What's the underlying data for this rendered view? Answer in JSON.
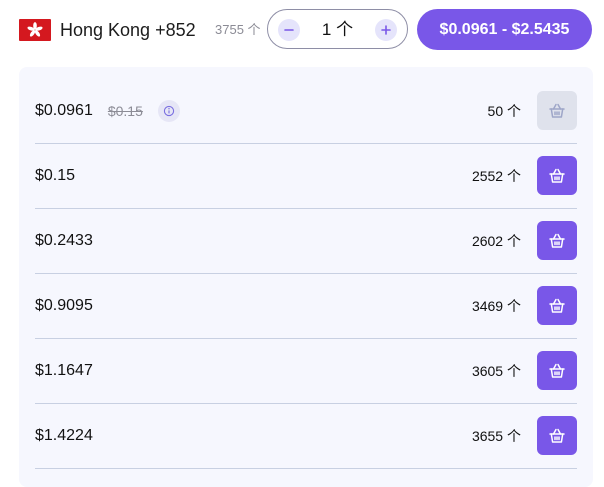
{
  "header": {
    "flag_icon": "hong-kong-flag-icon",
    "country": "Hong Kong +852",
    "stock": "3755 个",
    "quantity": "1 个",
    "price_range": "$0.0961 - $2.5435",
    "accent_color": "#7957e8"
  },
  "rows": [
    {
      "price": "$0.0961",
      "old_price": "$0.15",
      "count": "50 个",
      "cart_enabled": false,
      "info_icon": "info-icon"
    },
    {
      "price": "$0.15",
      "count": "2552 个",
      "cart_enabled": true
    },
    {
      "price": "$0.2433",
      "count": "2602 个",
      "cart_enabled": true
    },
    {
      "price": "$0.9095",
      "count": "3469 个",
      "cart_enabled": true
    },
    {
      "price": "$1.1647",
      "count": "3605 个",
      "cart_enabled": true
    },
    {
      "price": "$1.4224",
      "count": "3655 个",
      "cart_enabled": true
    }
  ]
}
